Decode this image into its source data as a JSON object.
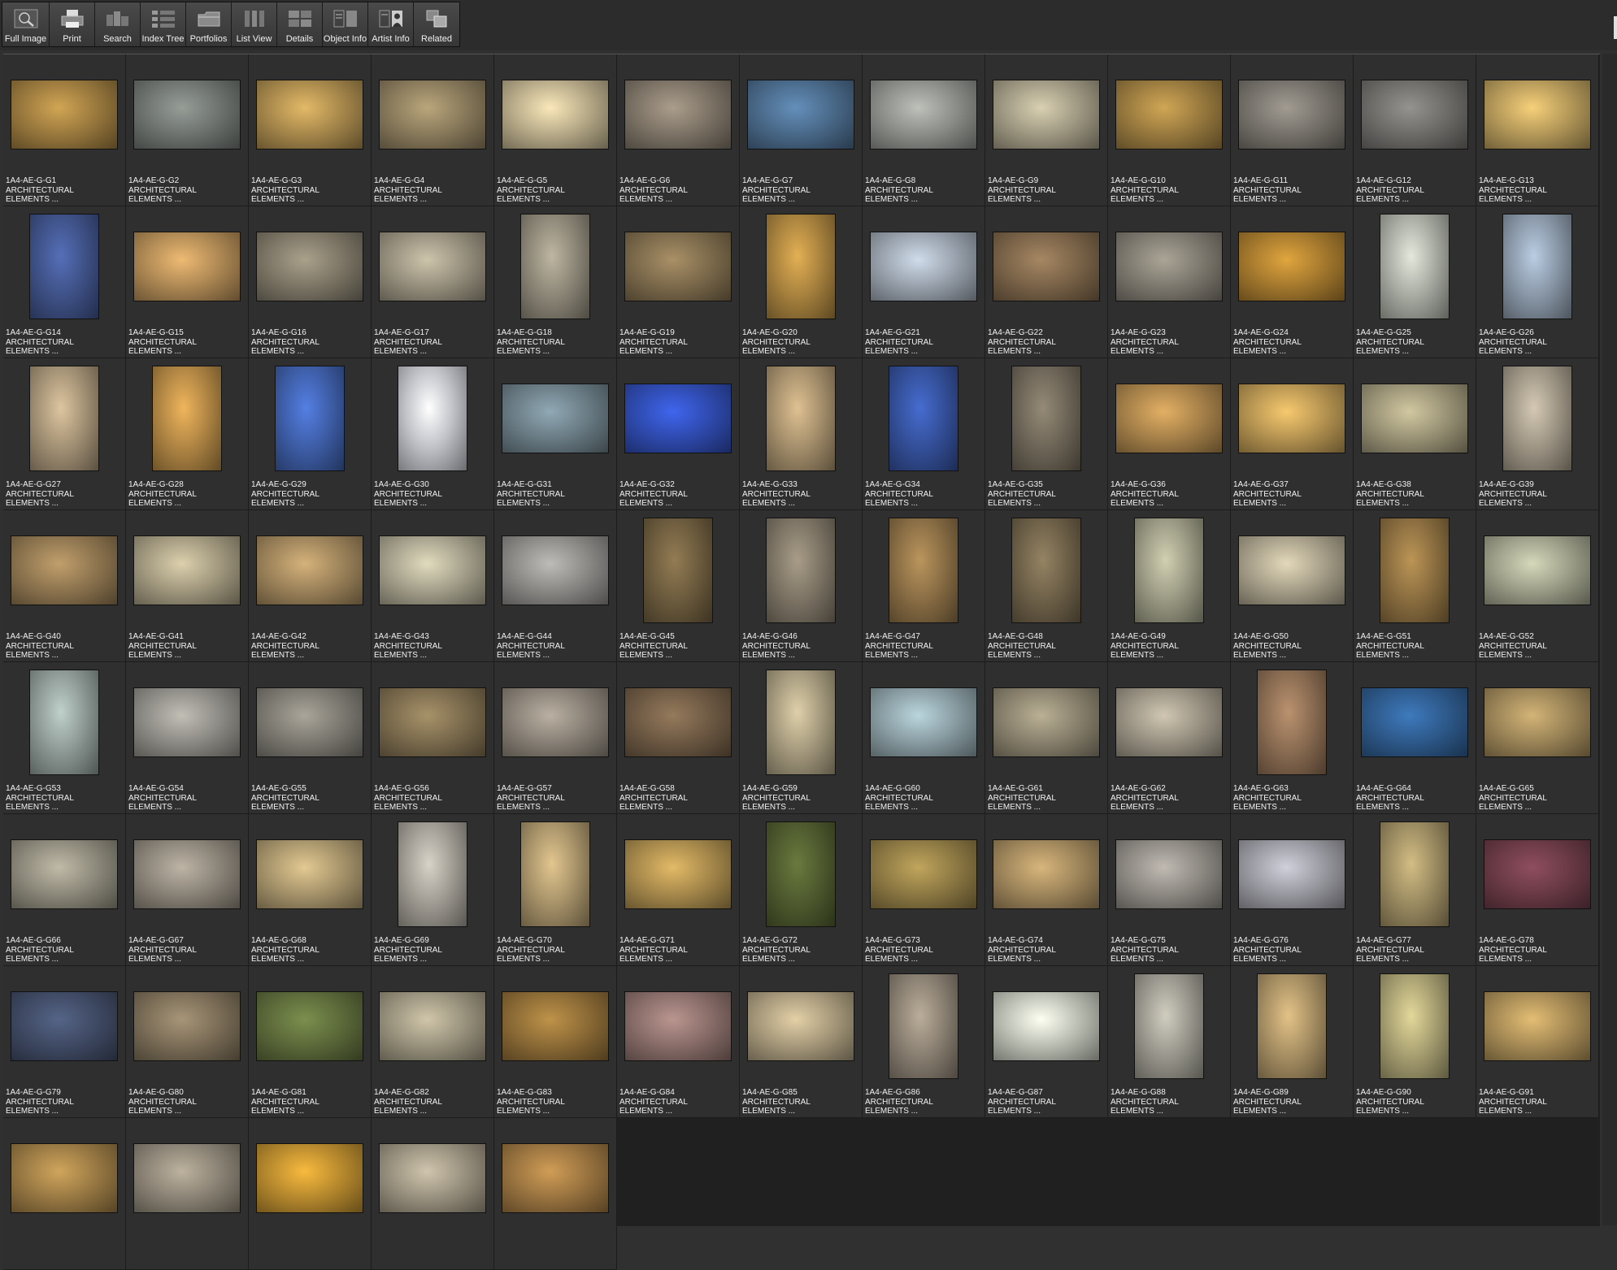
{
  "toolbar": {
    "buttons": [
      {
        "label": "Full Image",
        "icon": "magnifier-icon"
      },
      {
        "label": "Print",
        "icon": "printer-icon"
      },
      {
        "label": "Search",
        "icon": "search-icon"
      },
      {
        "label": "Index Tree",
        "icon": "index-tree-icon"
      },
      {
        "label": "Portfolios",
        "icon": "folder-icon"
      },
      {
        "label": "List View",
        "icon": "list-view-icon"
      },
      {
        "label": "Details",
        "icon": "details-icon"
      },
      {
        "label": "Object Info",
        "icon": "object-info-icon"
      },
      {
        "label": "Artist  Info",
        "icon": "artist-info-icon"
      },
      {
        "label": "Related",
        "icon": "related-icon"
      }
    ]
  },
  "caption_line2": "ARCHITECTURAL",
  "caption_line3": "ELEMENTS ...",
  "items": [
    {
      "id": "1A4-AE-G-G1",
      "c": "#9b7a3e",
      "o": "land"
    },
    {
      "id": "1A4-AE-G-G2",
      "c": "#6f7470",
      "o": "land"
    },
    {
      "id": "1A4-AE-G-G3",
      "c": "#a8894c",
      "o": "land"
    },
    {
      "id": "1A4-AE-G-G4",
      "c": "#8a7b5c",
      "o": "land"
    },
    {
      "id": "1A4-AE-G-G5",
      "c": "#b9ac8a",
      "o": "land"
    },
    {
      "id": "1A4-AE-G-G6",
      "c": "#7e7467",
      "o": "land"
    },
    {
      "id": "1A4-AE-G-G7",
      "c": "#4a6a8a",
      "o": "land"
    },
    {
      "id": "1A4-AE-G-G8",
      "c": "#8c8f8a",
      "o": "land"
    },
    {
      "id": "1A4-AE-G-G9",
      "c": "#a19a84",
      "o": "land"
    },
    {
      "id": "1A4-AE-G-G10",
      "c": "#9a7b3f",
      "o": "land"
    },
    {
      "id": "1A4-AE-G-G11",
      "c": "#77736c",
      "o": "land"
    },
    {
      "id": "1A4-AE-G-G12",
      "c": "#6e6d6a",
      "o": "land"
    },
    {
      "id": "1A4-AE-G-G13",
      "c": "#b69a5a",
      "o": "land"
    },
    {
      "id": "1A4-AE-G-G14",
      "c": "#3f5288",
      "o": "port"
    },
    {
      "id": "1A4-AE-G-G15",
      "c": "#b08a55",
      "o": "land"
    },
    {
      "id": "1A4-AE-G-G16",
      "c": "#7e7767",
      "o": "land"
    },
    {
      "id": "1A4-AE-G-G17",
      "c": "#98917f",
      "o": "land"
    },
    {
      "id": "1A4-AE-G-G18",
      "c": "#8d8778",
      "o": "port"
    },
    {
      "id": "1A4-AE-G-G19",
      "c": "#7d6b4c",
      "o": "land"
    },
    {
      "id": "1A4-AE-G-G20",
      "c": "#a8823e",
      "o": "port"
    },
    {
      "id": "1A4-AE-G-G21",
      "c": "#9aa3ae",
      "o": "land"
    },
    {
      "id": "1A4-AE-G-G22",
      "c": "#7b6449",
      "o": "land"
    },
    {
      "id": "1A4-AE-G-G23",
      "c": "#7f7a70",
      "o": "land"
    },
    {
      "id": "1A4-AE-G-G24",
      "c": "#a67a2e",
      "o": "land"
    },
    {
      "id": "1A4-AE-G-G25",
      "c": "#a9aca3",
      "o": "port"
    },
    {
      "id": "1A4-AE-G-G26",
      "c": "#8a98a8",
      "o": "port"
    },
    {
      "id": "1A4-AE-G-G27",
      "c": "#a49276",
      "o": "port"
    },
    {
      "id": "1A4-AE-G-G28",
      "c": "#b18644",
      "o": "port"
    },
    {
      "id": "1A4-AE-G-G29",
      "c": "#3e5ea8",
      "o": "port"
    },
    {
      "id": "1A4-AE-G-G30",
      "c": "#c0c2c8",
      "o": "port"
    },
    {
      "id": "1A4-AE-G-G31",
      "c": "#6b7d86",
      "o": "land"
    },
    {
      "id": "1A4-AE-G-G32",
      "c": "#2f4bb0",
      "o": "land"
    },
    {
      "id": "1A4-AE-G-G33",
      "c": "#a58f6c",
      "o": "port"
    },
    {
      "id": "1A4-AE-G-G34",
      "c": "#34509a",
      "o": "port"
    },
    {
      "id": "1A4-AE-G-G35",
      "c": "#6e6658",
      "o": "port"
    },
    {
      "id": "1A4-AE-G-G36",
      "c": "#a8824a",
      "o": "land"
    },
    {
      "id": "1A4-AE-G-G37",
      "c": "#b79552",
      "o": "land"
    },
    {
      "id": "1A4-AE-G-G38",
      "c": "#9b9477",
      "o": "land"
    },
    {
      "id": "1A4-AE-G-G39",
      "c": "#9e9585",
      "o": "port"
    },
    {
      "id": "1A4-AE-G-G40",
      "c": "#8f7650",
      "o": "land"
    },
    {
      "id": "1A4-AE-G-G41",
      "c": "#a39a80",
      "o": "land"
    },
    {
      "id": "1A4-AE-G-G42",
      "c": "#9e845b",
      "o": "land"
    },
    {
      "id": "1A4-AE-G-G43",
      "c": "#a7a28d",
      "o": "land"
    },
    {
      "id": "1A4-AE-G-G44",
      "c": "#8c8b88",
      "o": "land"
    },
    {
      "id": "1A4-AE-G-G45",
      "c": "#6d5c3e",
      "o": "port"
    },
    {
      "id": "1A4-AE-G-G46",
      "c": "#7d7465",
      "o": "port"
    },
    {
      "id": "1A4-AE-G-G47",
      "c": "#8a6e45",
      "o": "port"
    },
    {
      "id": "1A4-AE-G-G48",
      "c": "#6e6149",
      "o": "port"
    },
    {
      "id": "1A4-AE-G-G49",
      "c": "#9b9a84",
      "o": "port"
    },
    {
      "id": "1A4-AE-G-G50",
      "c": "#a8a08a",
      "o": "land"
    },
    {
      "id": "1A4-AE-G-G51",
      "c": "#8b6e40",
      "o": "port"
    },
    {
      "id": "1A4-AE-G-G52",
      "c": "#9ea08a",
      "o": "land"
    },
    {
      "id": "1A4-AE-G-G53",
      "c": "#8e9a96",
      "o": "port"
    },
    {
      "id": "1A4-AE-G-G54",
      "c": "#8f8d87",
      "o": "land"
    },
    {
      "id": "1A4-AE-G-G55",
      "c": "#7d7a72",
      "o": "land"
    },
    {
      "id": "1A4-AE-G-G56",
      "c": "#7c6c4e",
      "o": "land"
    },
    {
      "id": "1A4-AE-G-G57",
      "c": "#8a8278",
      "o": "land"
    },
    {
      "id": "1A4-AE-G-G58",
      "c": "#6e5a44",
      "o": "land"
    },
    {
      "id": "1A4-AE-G-G59",
      "c": "#a59a7e",
      "o": "port"
    },
    {
      "id": "1A4-AE-G-G60",
      "c": "#8a9ea4",
      "o": "land"
    },
    {
      "id": "1A4-AE-G-G61",
      "c": "#8a826e",
      "o": "land"
    },
    {
      "id": "1A4-AE-G-G62",
      "c": "#9a9384",
      "o": "land"
    },
    {
      "id": "1A4-AE-G-G63",
      "c": "#8a6c52",
      "o": "port"
    },
    {
      "id": "1A4-AE-G-G64",
      "c": "#2e5a8c",
      "o": "land"
    },
    {
      "id": "1A4-AE-G-G65",
      "c": "#9c8558",
      "o": "land"
    },
    {
      "id": "1A4-AE-G-G66",
      "c": "#8e8a7c",
      "o": "land"
    },
    {
      "id": "1A4-AE-G-G67",
      "c": "#8c857a",
      "o": "land"
    },
    {
      "id": "1A4-AE-G-G68",
      "c": "#a8956c",
      "o": "land"
    },
    {
      "id": "1A4-AE-G-G69",
      "c": "#a09c94",
      "o": "port"
    },
    {
      "id": "1A4-AE-G-G70",
      "c": "#a8936a",
      "o": "port"
    },
    {
      "id": "1A4-AE-G-G71",
      "c": "#a88a4c",
      "o": "land"
    },
    {
      "id": "1A4-AE-G-G72",
      "c": "#4e5a2e",
      "o": "port"
    },
    {
      "id": "1A4-AE-G-G73",
      "c": "#8e7a44",
      "o": "land"
    },
    {
      "id": "1A4-AE-G-G74",
      "c": "#a0875c",
      "o": "land"
    },
    {
      "id": "1A4-AE-G-G75",
      "c": "#8e8a84",
      "o": "land"
    },
    {
      "id": "1A4-AE-G-G76",
      "c": "#9a9aa2",
      "o": "land"
    },
    {
      "id": "1A4-AE-G-G77",
      "c": "#9c8c62",
      "o": "port"
    },
    {
      "id": "1A4-AE-G-G78",
      "c": "#6a3a46",
      "o": "land"
    },
    {
      "id": "1A4-AE-G-G79",
      "c": "#3f4a64",
      "o": "land"
    },
    {
      "id": "1A4-AE-G-G80",
      "c": "#7c6e58",
      "o": "land"
    },
    {
      "id": "1A4-AE-G-G81",
      "c": "#5c6a3a",
      "o": "land"
    },
    {
      "id": "1A4-AE-G-G82",
      "c": "#9a937e",
      "o": "land"
    },
    {
      "id": "1A4-AE-G-G83",
      "c": "#8d6c36",
      "o": "land"
    },
    {
      "id": "1A4-AE-G-G84",
      "c": "#8a6e6a",
      "o": "land"
    },
    {
      "id": "1A4-AE-G-G85",
      "c": "#a89a7c",
      "o": "land"
    },
    {
      "id": "1A4-AE-G-G86",
      "c": "#8a8072",
      "o": "port"
    },
    {
      "id": "1A4-AE-G-G87",
      "c": "#bcc0b4",
      "o": "land"
    },
    {
      "id": "1A4-AE-G-G88",
      "c": "#9a988e",
      "o": "port"
    },
    {
      "id": "1A4-AE-G-G89",
      "c": "#a89064",
      "o": "port"
    },
    {
      "id": "1A4-AE-G-G90",
      "c": "#a8a072",
      "o": "port"
    },
    {
      "id": "1A4-AE-G-G91",
      "c": "#a88c56",
      "o": "land"
    },
    {
      "id": "",
      "c": "#9a7a44",
      "o": "land"
    },
    {
      "id": "",
      "c": "#8c8476",
      "o": "land"
    },
    {
      "id": "",
      "c": "#b88a2e",
      "o": "land"
    },
    {
      "id": "",
      "c": "#9a9280",
      "o": "land"
    },
    {
      "id": "",
      "c": "#9a7440",
      "o": "land"
    }
  ]
}
